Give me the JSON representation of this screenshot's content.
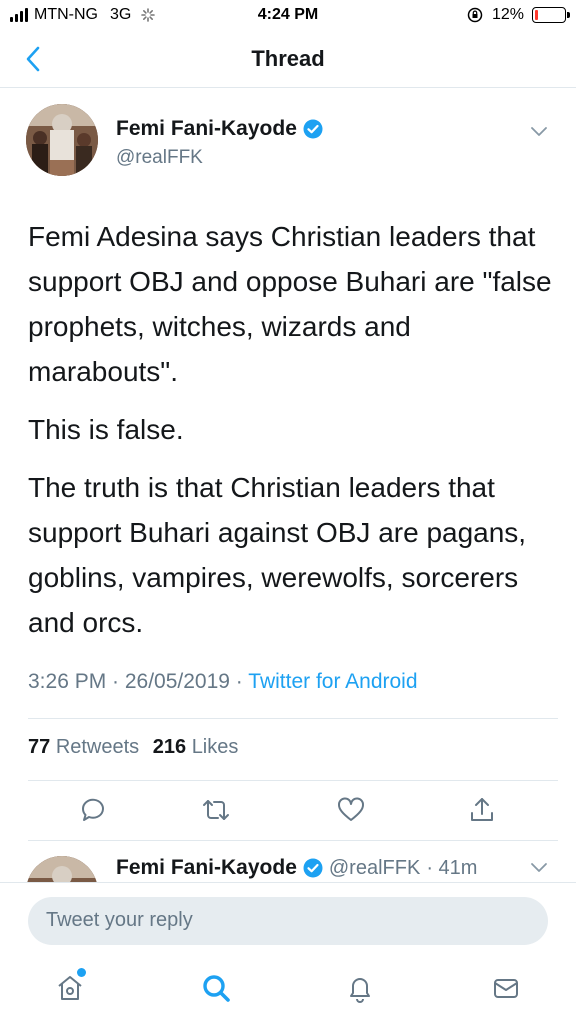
{
  "status_bar": {
    "carrier": "MTN-NG",
    "network": "3G",
    "time": "4:24 PM",
    "battery": "12%"
  },
  "nav": {
    "title": "Thread",
    "back_icon": "chevron-left-icon"
  },
  "tweet": {
    "author_name": "Femi Fani-Kayode",
    "author_handle": "@realFFK",
    "paragraphs": [
      "Femi Adesina says Christian leaders that support OBJ and oppose Buhari are \"false prophets, witches, wizards and marabouts\".",
      "This is false.",
      "The truth is that Christian leaders that support Buhari against OBJ are pagans, goblins, vampires, werewolfs, sorcerers and orcs."
    ],
    "timestamp": "3:26 PM · 26/05/2019 ·",
    "source": "Twitter for Android",
    "retweets_count": "77",
    "retweets_label": "Retweets",
    "likes_count": "216",
    "likes_label": "Likes"
  },
  "reply_preview": {
    "author_name": "Femi Fani-Kayode",
    "author_handle": "@realFFK",
    "age": "· 41m"
  },
  "reply_bar": {
    "placeholder": "Tweet your reply"
  },
  "tabs": [
    "home-icon",
    "search-icon",
    "notifications-icon",
    "messages-icon"
  ],
  "colors": {
    "accent": "#1da1f2",
    "secondary_text": "#657786",
    "battery_low": "#ff3b30"
  }
}
